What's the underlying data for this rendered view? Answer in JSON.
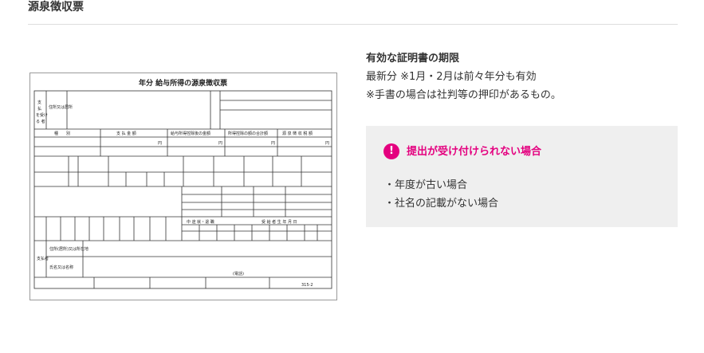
{
  "section": {
    "title": "源泉徴収票"
  },
  "document": {
    "header": "年分 給与所得の源泉徴収票",
    "labels": {
      "payee": [
        "支",
        "払",
        "を受け",
        "る 者"
      ],
      "address": "住所又は居所",
      "kind": "種　　別",
      "amount": "支 払 金 額",
      "deduction": "給与所得控除後の金額",
      "total_deduction": "所得控除の額の合計額",
      "withholding": "源 泉 徴 収 税 額",
      "payer_address": "住所(居所)又は所在地",
      "payer_name": "氏名又は名称",
      "payer": "支払者",
      "phone": "(電話)",
      "form_no": "315-2",
      "mid_header": "中 途 就・退 職",
      "birth_header": "受 給 者 生 年 月 日",
      "yen": "円"
    }
  },
  "validity": {
    "heading": "有効な証明書の期限",
    "line1": "最新分 ※1月・2月は前々年分も有効",
    "line2": "※手書の場合は社判等の押印があるもの。"
  },
  "warning": {
    "icon": "exclamation-circle-icon",
    "icon_glyph": "!",
    "accent_color": "#e4007f",
    "background": "#efefef",
    "title": "提出が受け付けられない場合",
    "items": [
      "・年度が古い場合",
      "・社名の記載がない場合"
    ]
  }
}
